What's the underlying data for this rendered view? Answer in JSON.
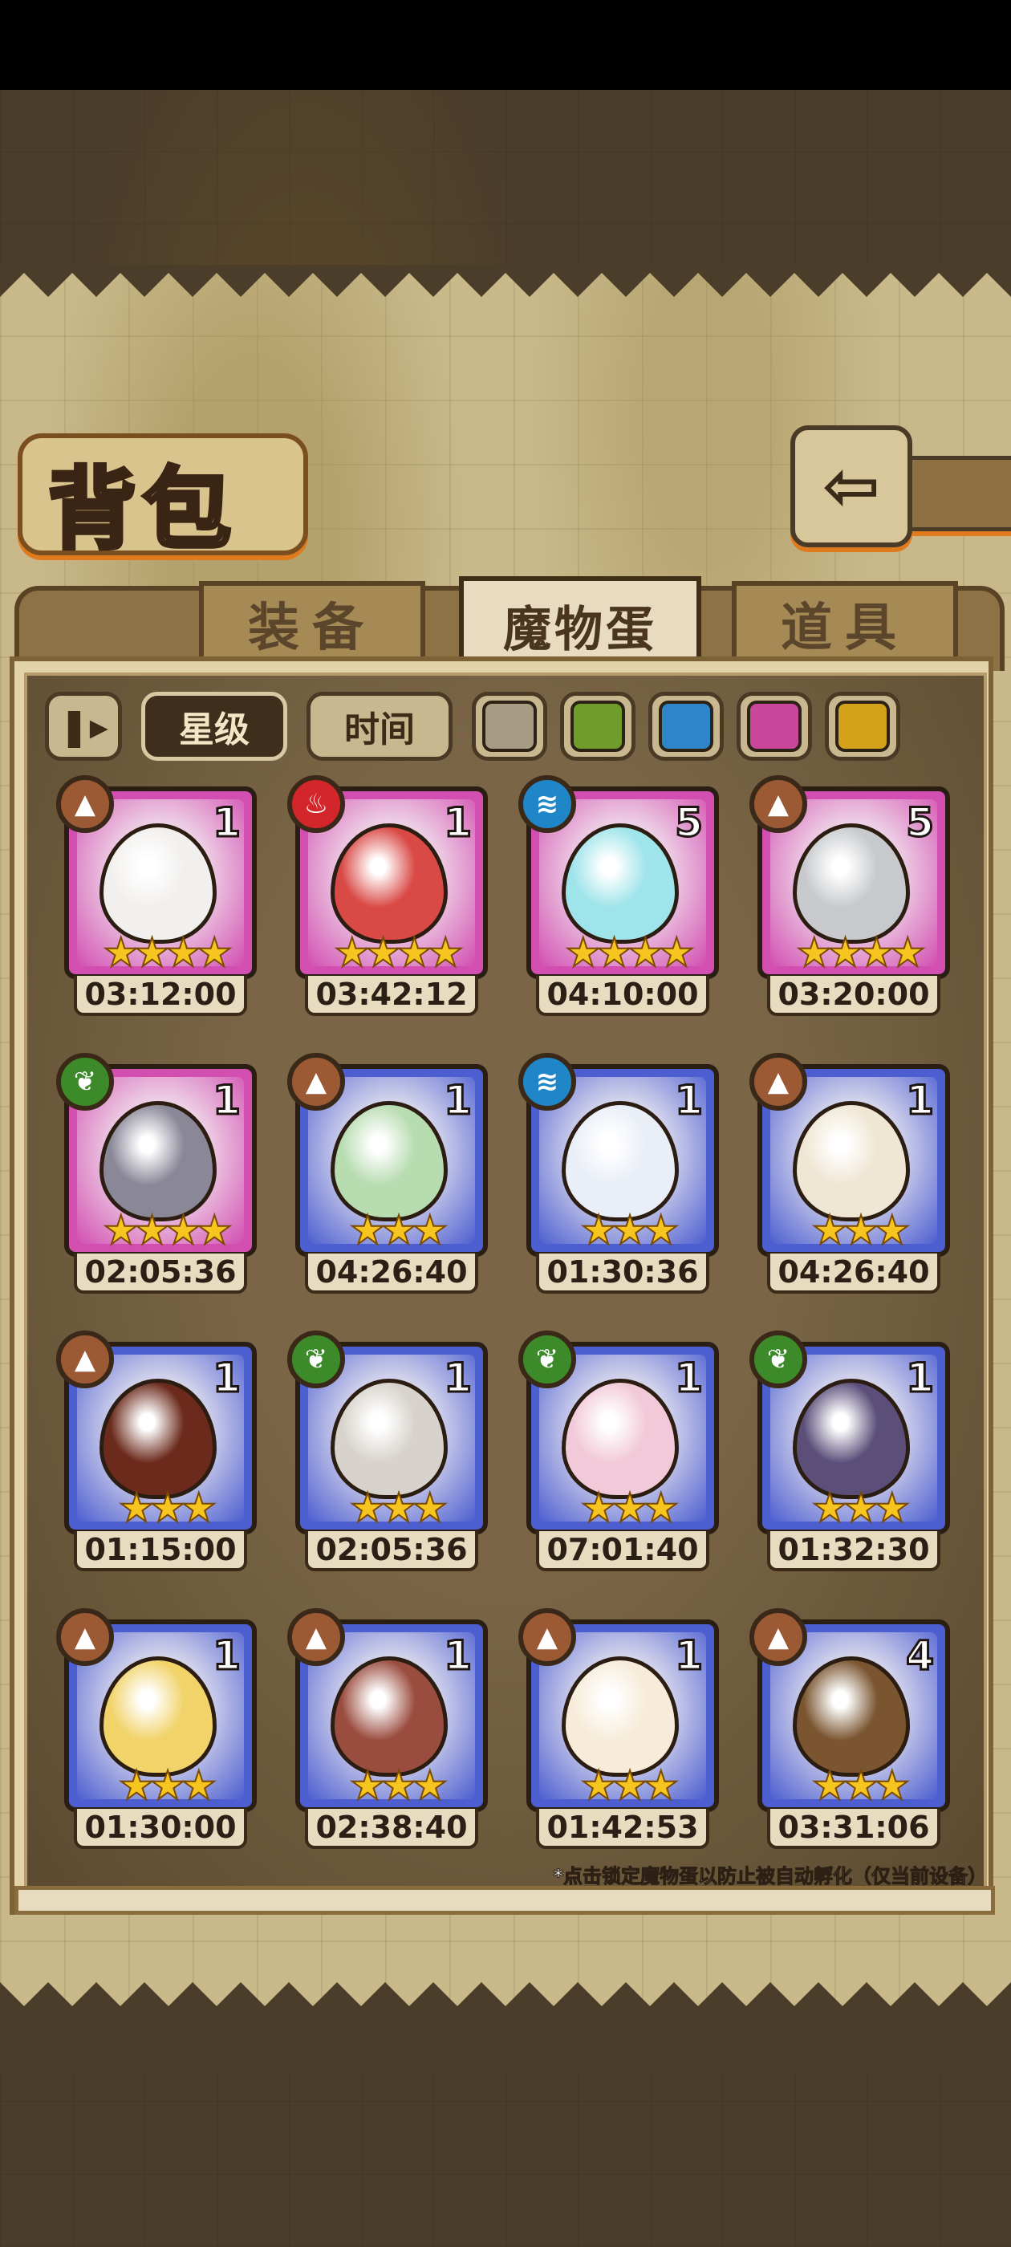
{
  "title": "背包",
  "back_button": "⇦",
  "tabs": [
    {
      "label": "装备",
      "active": false
    },
    {
      "label": "魔物蛋",
      "active": true
    },
    {
      "label": "道具",
      "active": false
    }
  ],
  "filters": {
    "sort_icon": "pause-sort-icon",
    "star_label": "星级",
    "time_label": "时间",
    "color_swatches": [
      "#a69c84",
      "#6f9c2a",
      "#2e86c8",
      "#c8479a",
      "#d4a21a"
    ]
  },
  "eggs": [
    {
      "element": "earth",
      "count": "1",
      "stars": "★★★★",
      "timer": "03:12:00",
      "rarity": "purple",
      "egg_color": "#f2f0ee"
    },
    {
      "element": "fire",
      "count": "1",
      "stars": "★★★★",
      "timer": "03:42:12",
      "rarity": "purple",
      "egg_color": "#d94a46"
    },
    {
      "element": "water",
      "count": "5",
      "stars": "★★★★",
      "timer": "04:10:00",
      "rarity": "purple",
      "egg_color": "#9fe4ea"
    },
    {
      "element": "earth",
      "count": "5",
      "stars": "★★★★",
      "timer": "03:20:00",
      "rarity": "purple",
      "egg_color": "#c7c9cc"
    },
    {
      "element": "nature",
      "count": "1",
      "stars": "★★★★",
      "timer": "02:05:36",
      "rarity": "purple",
      "egg_color": "#8a8797"
    },
    {
      "element": "earth",
      "count": "1",
      "stars": "★★★",
      "timer": "04:26:40",
      "rarity": "blue",
      "egg_color": "#b7dcb0"
    },
    {
      "element": "water",
      "count": "1",
      "stars": "★★★",
      "timer": "01:30:36",
      "rarity": "blue",
      "egg_color": "#e9eef7"
    },
    {
      "element": "earth",
      "count": "1",
      "stars": "★★★",
      "timer": "04:26:40",
      "rarity": "blue",
      "egg_color": "#efe6d3"
    },
    {
      "element": "earth",
      "count": "1",
      "stars": "★★★",
      "timer": "01:15:00",
      "rarity": "blue",
      "egg_color": "#6b2a1c"
    },
    {
      "element": "nature",
      "count": "1",
      "stars": "★★★",
      "timer": "02:05:36",
      "rarity": "blue",
      "egg_color": "#d7d2cb"
    },
    {
      "element": "nature",
      "count": "1",
      "stars": "★★★",
      "timer": "07:01:40",
      "rarity": "blue",
      "egg_color": "#f2c9d8"
    },
    {
      "element": "nature",
      "count": "1",
      "stars": "★★★",
      "timer": "01:32:30",
      "rarity": "blue",
      "egg_color": "#5b4f7a"
    },
    {
      "element": "earth",
      "count": "1",
      "stars": "★★★",
      "timer": "01:30:00",
      "rarity": "blue",
      "egg_color": "#f1d36a"
    },
    {
      "element": "earth",
      "count": "1",
      "stars": "★★★",
      "timer": "02:38:40",
      "rarity": "blue",
      "egg_color": "#9a4c3f"
    },
    {
      "element": "earth",
      "count": "1",
      "stars": "★★★",
      "timer": "01:42:53",
      "rarity": "blue",
      "egg_color": "#f6ecd9"
    },
    {
      "element": "earth",
      "count": "4",
      "stars": "★★★",
      "timer": "03:31:06",
      "rarity": "blue",
      "egg_color": "#7a5530"
    }
  ],
  "footnote": "*点击锁定魔物蛋以防止被自动孵化（仅当前设备）",
  "colors": {
    "purple_frame": "#d24fb1",
    "blue_frame": "#4d5fd0",
    "earth_badge": "#9b5a34",
    "fire_badge": "#d2262b",
    "water_badge": "#1f86c8",
    "nature_badge": "#3d8a2a"
  }
}
